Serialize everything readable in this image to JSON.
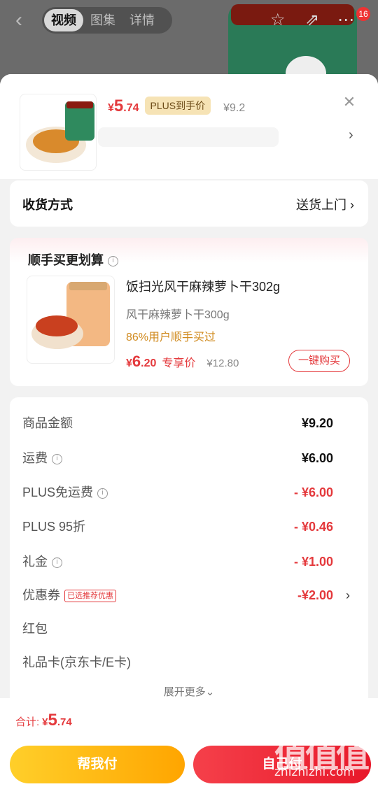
{
  "top": {
    "tabs": [
      "视频",
      "图集",
      "详情"
    ],
    "cart_badge": "16",
    "icons": [
      "back-icon",
      "star-icon",
      "share-icon",
      "more-icon"
    ]
  },
  "product": {
    "price_symbol": "¥",
    "price_int": "5",
    "price_dec": ".74",
    "plus_tag": "PLUS到手价",
    "original_price": "¥9.2"
  },
  "delivery": {
    "label": "收货方式",
    "value": "送货上门"
  },
  "addon": {
    "title": "顺手买更划算",
    "name": "饭扫光风干麻辣萝卜干302g",
    "spec": "风干麻辣萝卜干300g",
    "social": "86%用户顺手买过",
    "price_symbol": "¥",
    "price_int": "6",
    "price_dec": ".20",
    "exclusive": "专享价",
    "original": "¥12.80",
    "buy_label": "一键购买"
  },
  "summary": {
    "rows": [
      {
        "k": "商品金额",
        "v": "¥9.20"
      },
      {
        "k": "运费",
        "v": "¥6.00"
      },
      {
        "k": "PLUS免运费",
        "v": "- ¥6.00"
      },
      {
        "k": "PLUS 95折",
        "v": "- ¥0.46"
      },
      {
        "k": "礼金",
        "v": "- ¥1.00"
      },
      {
        "k": "优惠券",
        "v": "-¥2.00",
        "tag": "已选推荐优惠"
      },
      {
        "k": "红包",
        "v": ""
      },
      {
        "k": "礼品卡(京东卡/E卡)",
        "v": ""
      }
    ],
    "expand": "展开更多⌄"
  },
  "footer": {
    "total_label": "合计:",
    "total_symbol": "¥",
    "total_int": "5",
    "total_dec": ".74",
    "help_pay": "帮我付",
    "self_pay": "自己付"
  },
  "watermark": {
    "mark": "值值值",
    "url": "zhizhizhi.com"
  },
  "colors": {
    "accent_red": "#e4393c",
    "plus_gold": "#f6e3b5",
    "social_orange": "#d08a1e"
  }
}
